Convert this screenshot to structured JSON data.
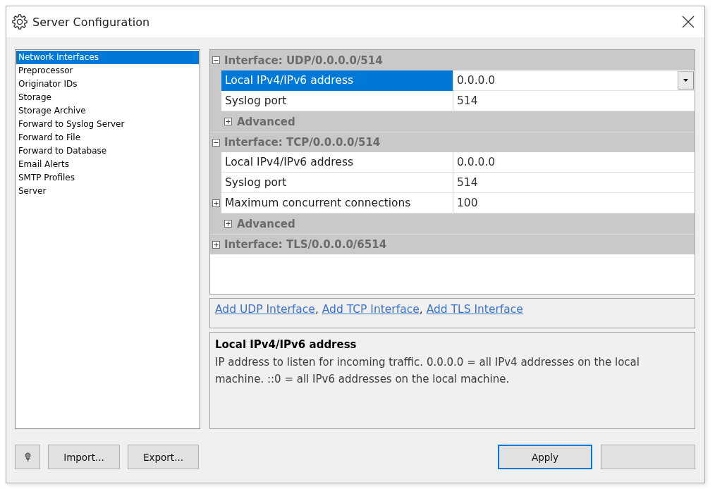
{
  "window": {
    "title": "Server Configuration"
  },
  "sidebar": {
    "items": [
      {
        "label": "Network Interfaces",
        "selected": true
      },
      {
        "label": "Preprocessor",
        "selected": false
      },
      {
        "label": "Originator IDs",
        "selected": false
      },
      {
        "label": "Storage",
        "selected": false
      },
      {
        "label": "Storage Archive",
        "selected": false
      },
      {
        "label": "Forward to Syslog Server",
        "selected": false
      },
      {
        "label": "Forward to File",
        "selected": false
      },
      {
        "label": "Forward to Database",
        "selected": false
      },
      {
        "label": "Email Alerts",
        "selected": false
      },
      {
        "label": "SMTP Profiles",
        "selected": false
      },
      {
        "label": "Server",
        "selected": false
      }
    ]
  },
  "property_grid": {
    "groups": [
      {
        "title": "Interface: UDP/0.0.0.0/514",
        "expanded": true,
        "rows": [
          {
            "kind": "dropdown",
            "label": "Local IPv4/IPv6 address",
            "value": "0.0.0.0",
            "selected": true
          },
          {
            "kind": "text",
            "label": "Syslog port",
            "value": "514",
            "selected": false
          },
          {
            "kind": "category",
            "label": "Advanced",
            "expanded": false,
            "selected": false
          }
        ]
      },
      {
        "title": "Interface: TCP/0.0.0.0/514",
        "expanded": true,
        "rows": [
          {
            "kind": "text",
            "label": "Local IPv4/IPv6 address",
            "value": "0.0.0.0",
            "selected": false
          },
          {
            "kind": "text",
            "label": "Syslog port",
            "value": "514",
            "selected": false
          },
          {
            "kind": "expandable",
            "label": "Maximum concurrent connections",
            "value": "100",
            "expanded": false,
            "selected": false
          },
          {
            "kind": "category",
            "label": "Advanced",
            "expanded": false,
            "selected": false
          }
        ]
      },
      {
        "title": "Interface: TLS/0.0.0.0/6514",
        "expanded": false
      }
    ]
  },
  "links": [
    {
      "label": "Add UDP Interface",
      "separator": ","
    },
    {
      "label": "Add TCP Interface",
      "separator": ","
    },
    {
      "label": "Add TLS Interface"
    }
  ],
  "description": {
    "title": "Local IPv4/IPv6 address",
    "text": "IP address to listen for incoming traffic. 0.0.0.0 = all IPv4 addresses on the local machine. ::0 = all IPv6 addresses on the local machine."
  },
  "buttons": {
    "left": [
      {
        "kind": "icon",
        "focused": false
      },
      {
        "kind": "label",
        "label": "Import...",
        "focused": false
      },
      {
        "kind": "label",
        "label": "Export...",
        "focused": false
      }
    ],
    "right": [
      {
        "kind": "label",
        "label": "Apply",
        "focused": true
      },
      {
        "kind": "blank",
        "focused": false
      }
    ]
  }
}
